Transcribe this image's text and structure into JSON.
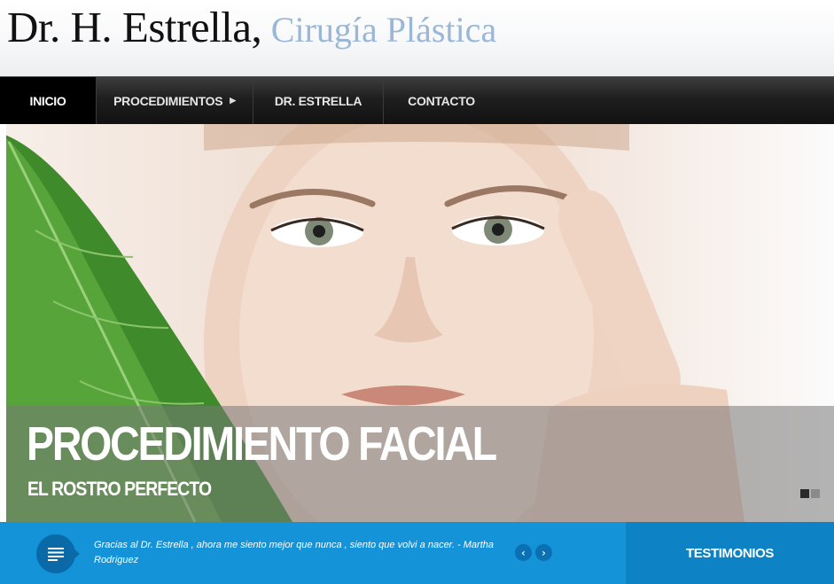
{
  "header": {
    "logo_name": "Dr. H. Estrella",
    "logo_comma": ",",
    "logo_tagline": "Cirugía Plástica"
  },
  "nav": {
    "items": [
      {
        "label": "INICIO",
        "active": true
      },
      {
        "label": "PROCEDIMIENTOS",
        "has_submenu": true,
        "submenu_icon": "triangle-right-icon"
      },
      {
        "label": "DR. ESTRELLA"
      },
      {
        "label": "CONTACTO"
      }
    ]
  },
  "hero": {
    "title": "PROCEDIMIENTO FACIAL",
    "subtitle": "EL ROSTRO PERFECTO",
    "image": "woman-face-with-green-leaf",
    "slides_total": 2,
    "slide_active": 1
  },
  "testimonials": {
    "icon": "quote-lines-icon",
    "text": "Gracias al Dr. Estrella , ahora me siento mejor que nunca , siento que volvi a nacer. - Martha Rodriguez",
    "prev_icon": "chevron-left-icon",
    "next_icon": "chevron-right-icon",
    "prev_glyph": "‹",
    "next_glyph": "›",
    "label": "TESTIMONIOS"
  },
  "colors": {
    "nav_bg": "#1f1f1f",
    "accent_blue": "#1493d8",
    "accent_blue_dark": "#0d82c4",
    "tagline": "#9ab7d8"
  }
}
